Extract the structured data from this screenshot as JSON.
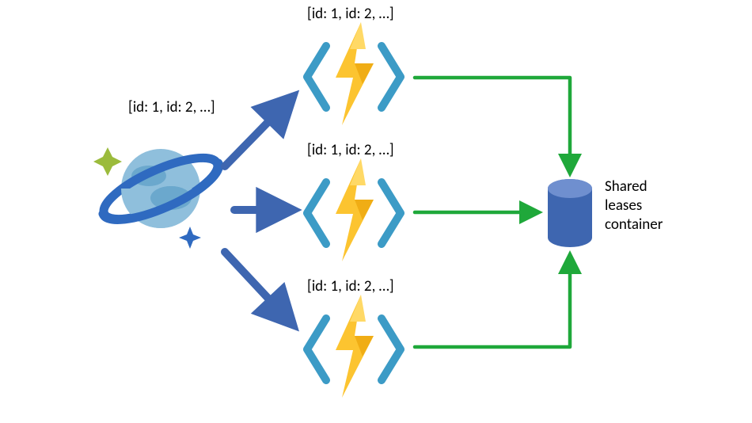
{
  "nodes": {
    "source": {
      "label": "[id: 1, id: 2, …]",
      "kind": "cosmos-db",
      "semantic": "source-change-feed"
    },
    "functions": [
      {
        "label": "[id: 1, id: 2, …]",
        "kind": "azure-function",
        "semantic": "consumer-1"
      },
      {
        "label": "[id: 1, id: 2, …]",
        "kind": "azure-function",
        "semantic": "consumer-2"
      },
      {
        "label": "[id: 1, id: 2, …]",
        "kind": "azure-function",
        "semantic": "consumer-3"
      }
    ],
    "leaseStore": {
      "label": "Shared\nleases\ncontainer",
      "kind": "database",
      "semantic": "shared-leases-container"
    }
  },
  "edges": {
    "sourceToFunctions": {
      "color": "#3E66B0",
      "style": "thick-arrow",
      "count": 3
    },
    "functionsToLeases": {
      "color": "#1FA83A",
      "style": "thin-right-angle-arrow",
      "count": 3
    }
  },
  "colors": {
    "bracket": "#3C9BC6",
    "boltFill": "#FCC430",
    "boltShadow": "#E69A00",
    "arrowBlue": "#3E66B0",
    "arrowGreen": "#1FA83A",
    "dbFill": "#3E66B0",
    "globeRing": "#2F6AC0",
    "globeBody": "#8FBFDC",
    "globeCloud": "#6BA8CD",
    "sparkle1": "#9BBB3C",
    "sparkle2": "#2F6AC0"
  }
}
